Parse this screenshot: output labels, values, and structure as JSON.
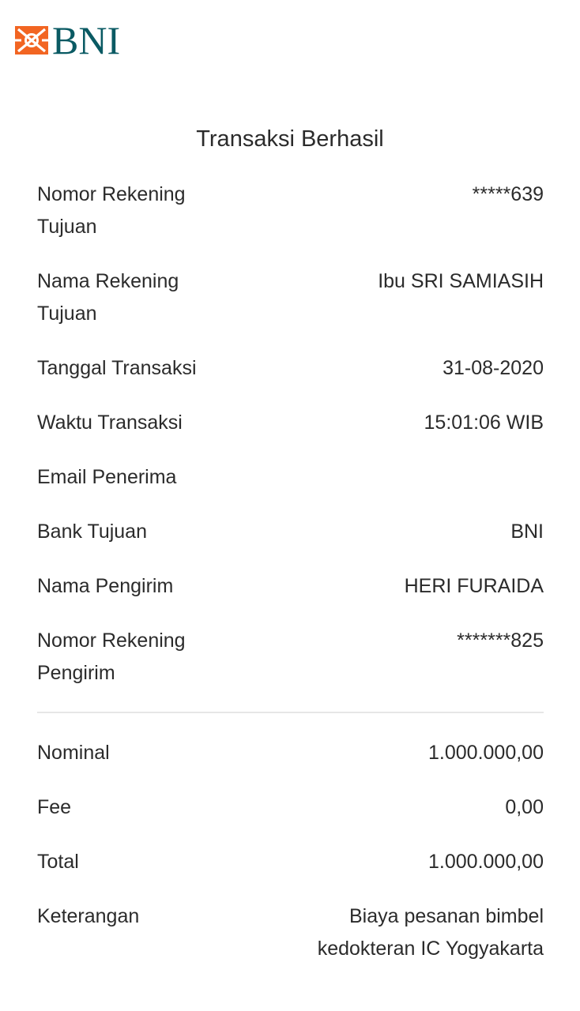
{
  "header": {
    "brand": "BNI",
    "logo_icon": "bni-logo-mark-icon",
    "brand_color": "#0a5a63",
    "logo_accent_color": "#f26522"
  },
  "receipt": {
    "title": "Transaksi Berhasil",
    "details": [
      {
        "label": "Nomor Rekening Tujuan",
        "value": "*****639"
      },
      {
        "label": "Nama Rekening Tujuan",
        "value": "Ibu SRI SAMIASIH"
      },
      {
        "label": "Tanggal Transaksi",
        "value": "31-08-2020"
      },
      {
        "label": "Waktu Transaksi",
        "value": "15:01:06 WIB"
      },
      {
        "label": "Email Penerima",
        "value": ""
      },
      {
        "label": "Bank Tujuan",
        "value": "BNI"
      },
      {
        "label": "Nama Pengirim",
        "value": "HERI FURAIDA"
      },
      {
        "label": "Nomor Rekening Pengirim",
        "value": "*******825"
      }
    ],
    "amounts": [
      {
        "label": "Nominal",
        "value": "1.000.000,00"
      },
      {
        "label": "Fee",
        "value": "0,00"
      },
      {
        "label": "Total",
        "value": "1.000.000,00"
      },
      {
        "label": "Keterangan",
        "value": "Biaya pesanan bimbel kedokteran IC Yogyakarta"
      }
    ]
  }
}
